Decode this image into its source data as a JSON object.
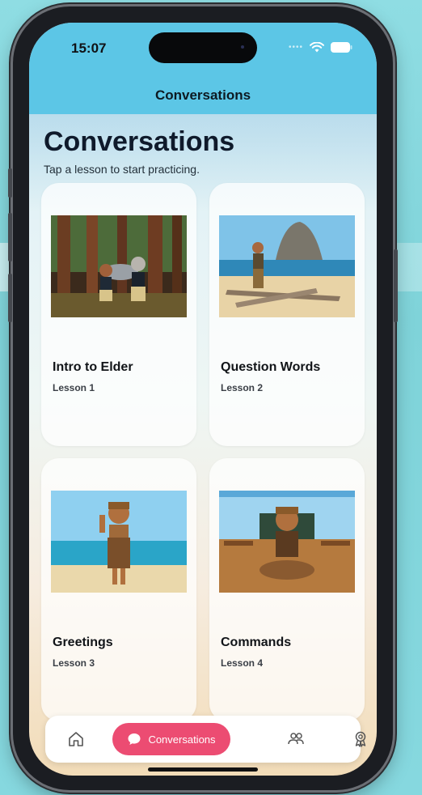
{
  "status": {
    "time": "15:07"
  },
  "nav": {
    "title": "Conversations"
  },
  "page": {
    "title": "Conversations",
    "subtitle": "Tap a lesson to start practicing."
  },
  "lessons": [
    {
      "title": "Intro to Elder",
      "subtitle": "Lesson 1",
      "image": "forest-elder-illustration"
    },
    {
      "title": "Question Words",
      "subtitle": "Lesson 2",
      "image": "beach-sea-stack-illustration"
    },
    {
      "title": "Greetings",
      "subtitle": "Lesson 3",
      "image": "beach-waving-child-illustration"
    },
    {
      "title": "Commands",
      "subtitle": "Lesson 4",
      "image": "classroom-child-illustration"
    }
  ],
  "tabbar": {
    "items": [
      {
        "icon": "home-icon",
        "label": ""
      },
      {
        "icon": "chat-bubble-icon",
        "label": "Conversations",
        "active": true
      },
      {
        "icon": "people-icon",
        "label": ""
      },
      {
        "icon": "award-icon",
        "label": ""
      }
    ]
  },
  "colors": {
    "accent": "#ec4c72",
    "header": "#5cc6e6"
  }
}
